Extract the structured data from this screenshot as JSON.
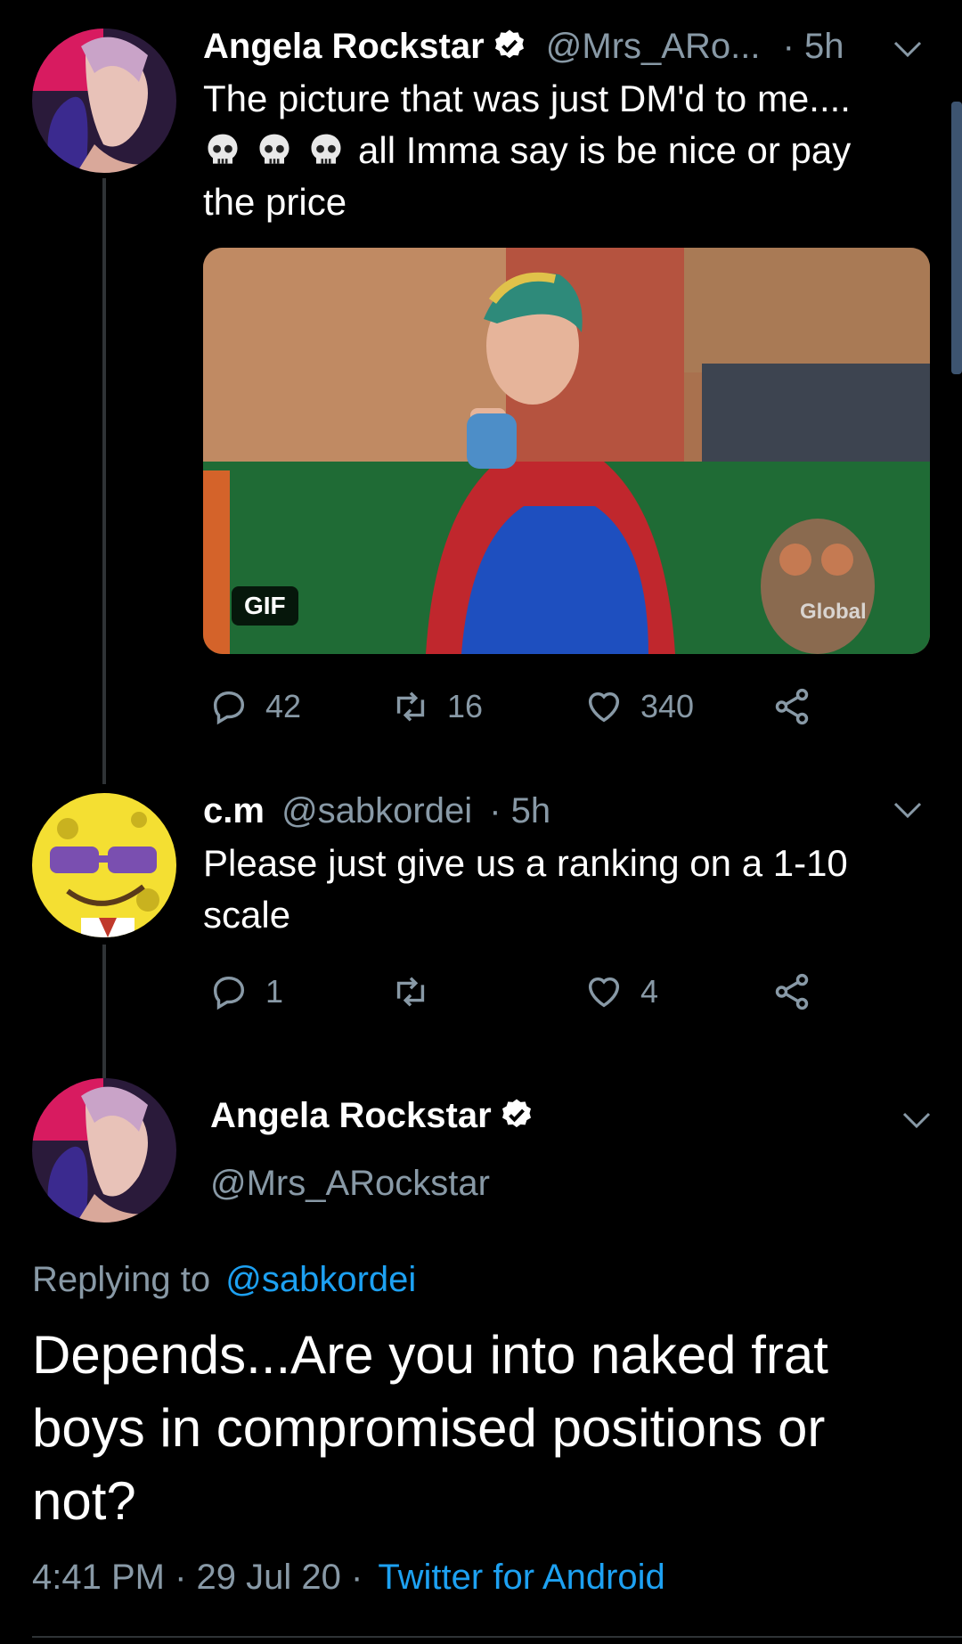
{
  "tweet1": {
    "name": "Angela Rockstar",
    "handle": "@Mrs_ARo...",
    "time": "· 5h",
    "text_line1": "The picture that was just DM'd to me....",
    "text_line2": "all Imma say is be nice or pay",
    "text_line3": "the price",
    "gif_badge": "GIF",
    "gif_watermark": "Global",
    "replies": "42",
    "retweets": "16",
    "likes": "340"
  },
  "tweet2": {
    "name": "c.m",
    "handle": "@sabkordei",
    "time": "· 5h",
    "text_line1": "Please just give us a ranking on a 1-10",
    "text_line2": "scale",
    "replies": "1",
    "retweets": "",
    "likes": "4"
  },
  "tweet3": {
    "name": "Angela Rockstar",
    "handle": "@Mrs_ARockstar",
    "replying_prefix": "Replying to",
    "replying_to": "@sabkordei",
    "text_line1": "Depends...Are you into naked frat",
    "text_line2": "boys in compromised positions or",
    "text_line3": "not?",
    "timestamp": "4:41 PM · 29 Jul 20 ·",
    "client": "Twitter for Android"
  },
  "colors": {
    "background": "#000000",
    "muted": "#8899a6",
    "link": "#1da1f2",
    "verified_badge": "#ffffff"
  }
}
